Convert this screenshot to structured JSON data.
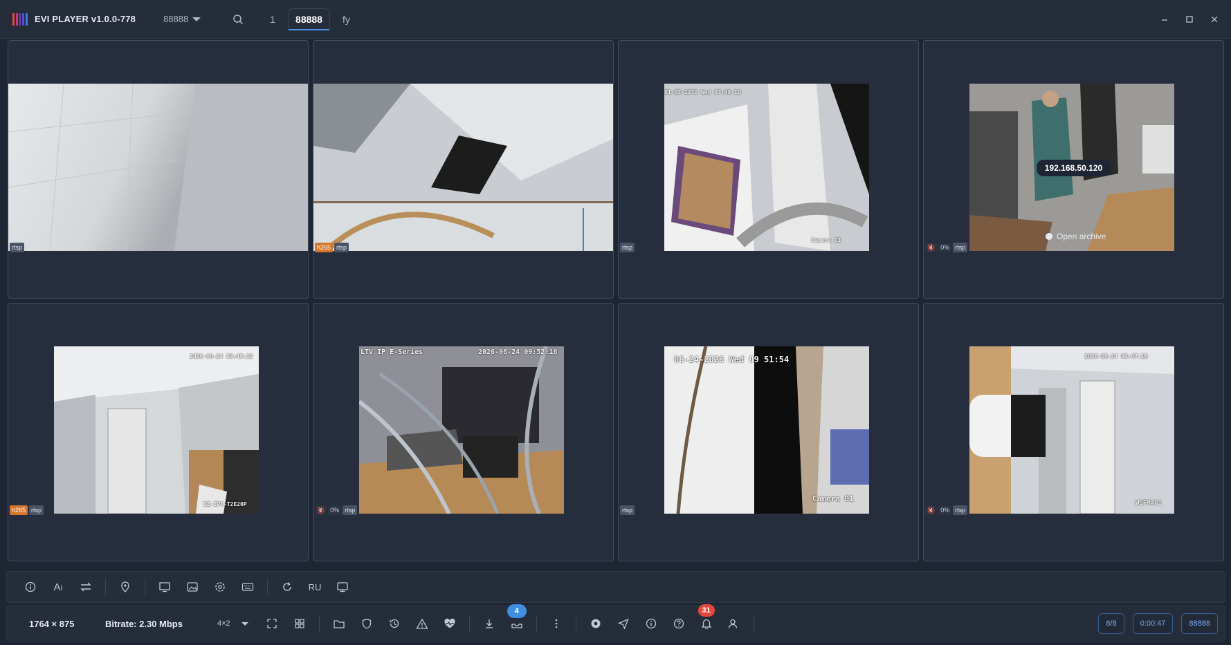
{
  "window": {
    "title": "EVI PLAYER v1.0.0-778",
    "workspace": "88888",
    "tabs": [
      {
        "label": "1"
      },
      {
        "label": "88888"
      },
      {
        "label": "fy"
      }
    ],
    "active_tab": "88888"
  },
  "cells": [
    {
      "badges": [
        "rtsp"
      ],
      "mute": false,
      "volume": ""
    },
    {
      "badges": [
        "h265",
        "rtsp"
      ],
      "mute": false,
      "volume": ""
    },
    {
      "badges": [
        "rtsp"
      ],
      "mute": false,
      "volume": "",
      "osd_top": "01-03-1970 Wed 07:48:10",
      "osd_bottom": "Camera 01"
    },
    {
      "badges": [
        "rtsp"
      ],
      "mute": true,
      "volume": "0%",
      "ip": "192.168.50.120",
      "open_archive": "Open archive"
    },
    {
      "badges": [
        "h265",
        "rtsp"
      ],
      "mute": false,
      "volume": "",
      "osd_top": "2026-06-24 09:49:19",
      "osd_bottom": "EZ-IPC-T2E20P"
    },
    {
      "badges": [
        "rtsp"
      ],
      "mute": true,
      "volume": "0%",
      "osd_top_left": "LTV IP E-Series",
      "osd_top": "2026-06-24 09:52:16"
    },
    {
      "badges": [
        "rtsp"
      ],
      "mute": false,
      "volume": "",
      "osd_top": "06-24-2026 Wed 09 51:54",
      "osd_bottom": "Camera 01"
    },
    {
      "badges": [
        "rtsp"
      ],
      "mute": true,
      "volume": "0%",
      "osd_top": "2026-06-24 09:47:16",
      "osd_bottom": "WSFM401"
    }
  ],
  "toolbar1": {
    "icons": [
      "info-icon",
      "ai-text-icon",
      "swap-icon",
      "location-pin-icon",
      "monitor-icon",
      "image-icon",
      "settings-icon",
      "keyboard-icon",
      "refresh-icon",
      "monitor-2-icon"
    ],
    "language": "RU"
  },
  "toolbar2": {
    "resolution": "1764 × 875",
    "bitrate": "Bitrate: 2.30 Mbps",
    "layout": "4×2",
    "download_badge": "4",
    "notification_badge": "31",
    "cameras": "8/8",
    "timer": "0:00:47",
    "workspace": "88888"
  },
  "colors": {
    "background": "#1e2533",
    "panel": "#252c3a",
    "accent": "#4f8fe6",
    "badge_h265": "#d5762a",
    "badge_notification": "#e5483b",
    "badge_download": "#3f8fe0"
  }
}
